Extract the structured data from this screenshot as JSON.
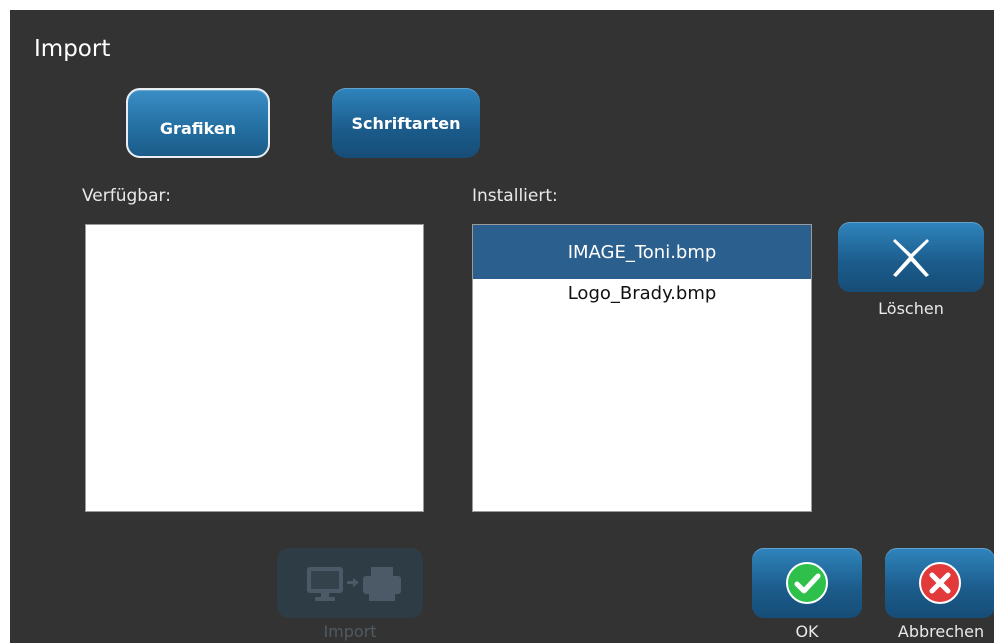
{
  "dialog": {
    "title": "Import"
  },
  "tabs": [
    {
      "label": "Grafiken",
      "active": true
    },
    {
      "label": "Schriftarten",
      "active": false
    }
  ],
  "available": {
    "label": "Verfügbar:",
    "items": []
  },
  "installed": {
    "label": "Installiert:",
    "items": [
      "IMAGE_Toni.bmp",
      "Logo_Brady.bmp"
    ],
    "selected_index": 0
  },
  "buttons": {
    "delete_label": "Löschen",
    "import_label": "Import",
    "import_enabled": false,
    "ok_label": "OK",
    "cancel_label": "Abbrechen"
  },
  "icons": {
    "delete": "close-x-icon",
    "import": "computer-to-printer-icon",
    "ok": "check-circle-icon",
    "cancel": "x-circle-icon"
  },
  "colors": {
    "background": "#333333",
    "button_blue": "#1b5b8a",
    "selected_row": "#2a5f8e",
    "ok_green": "#2ec04a",
    "cancel_red": "#e23a3a"
  }
}
